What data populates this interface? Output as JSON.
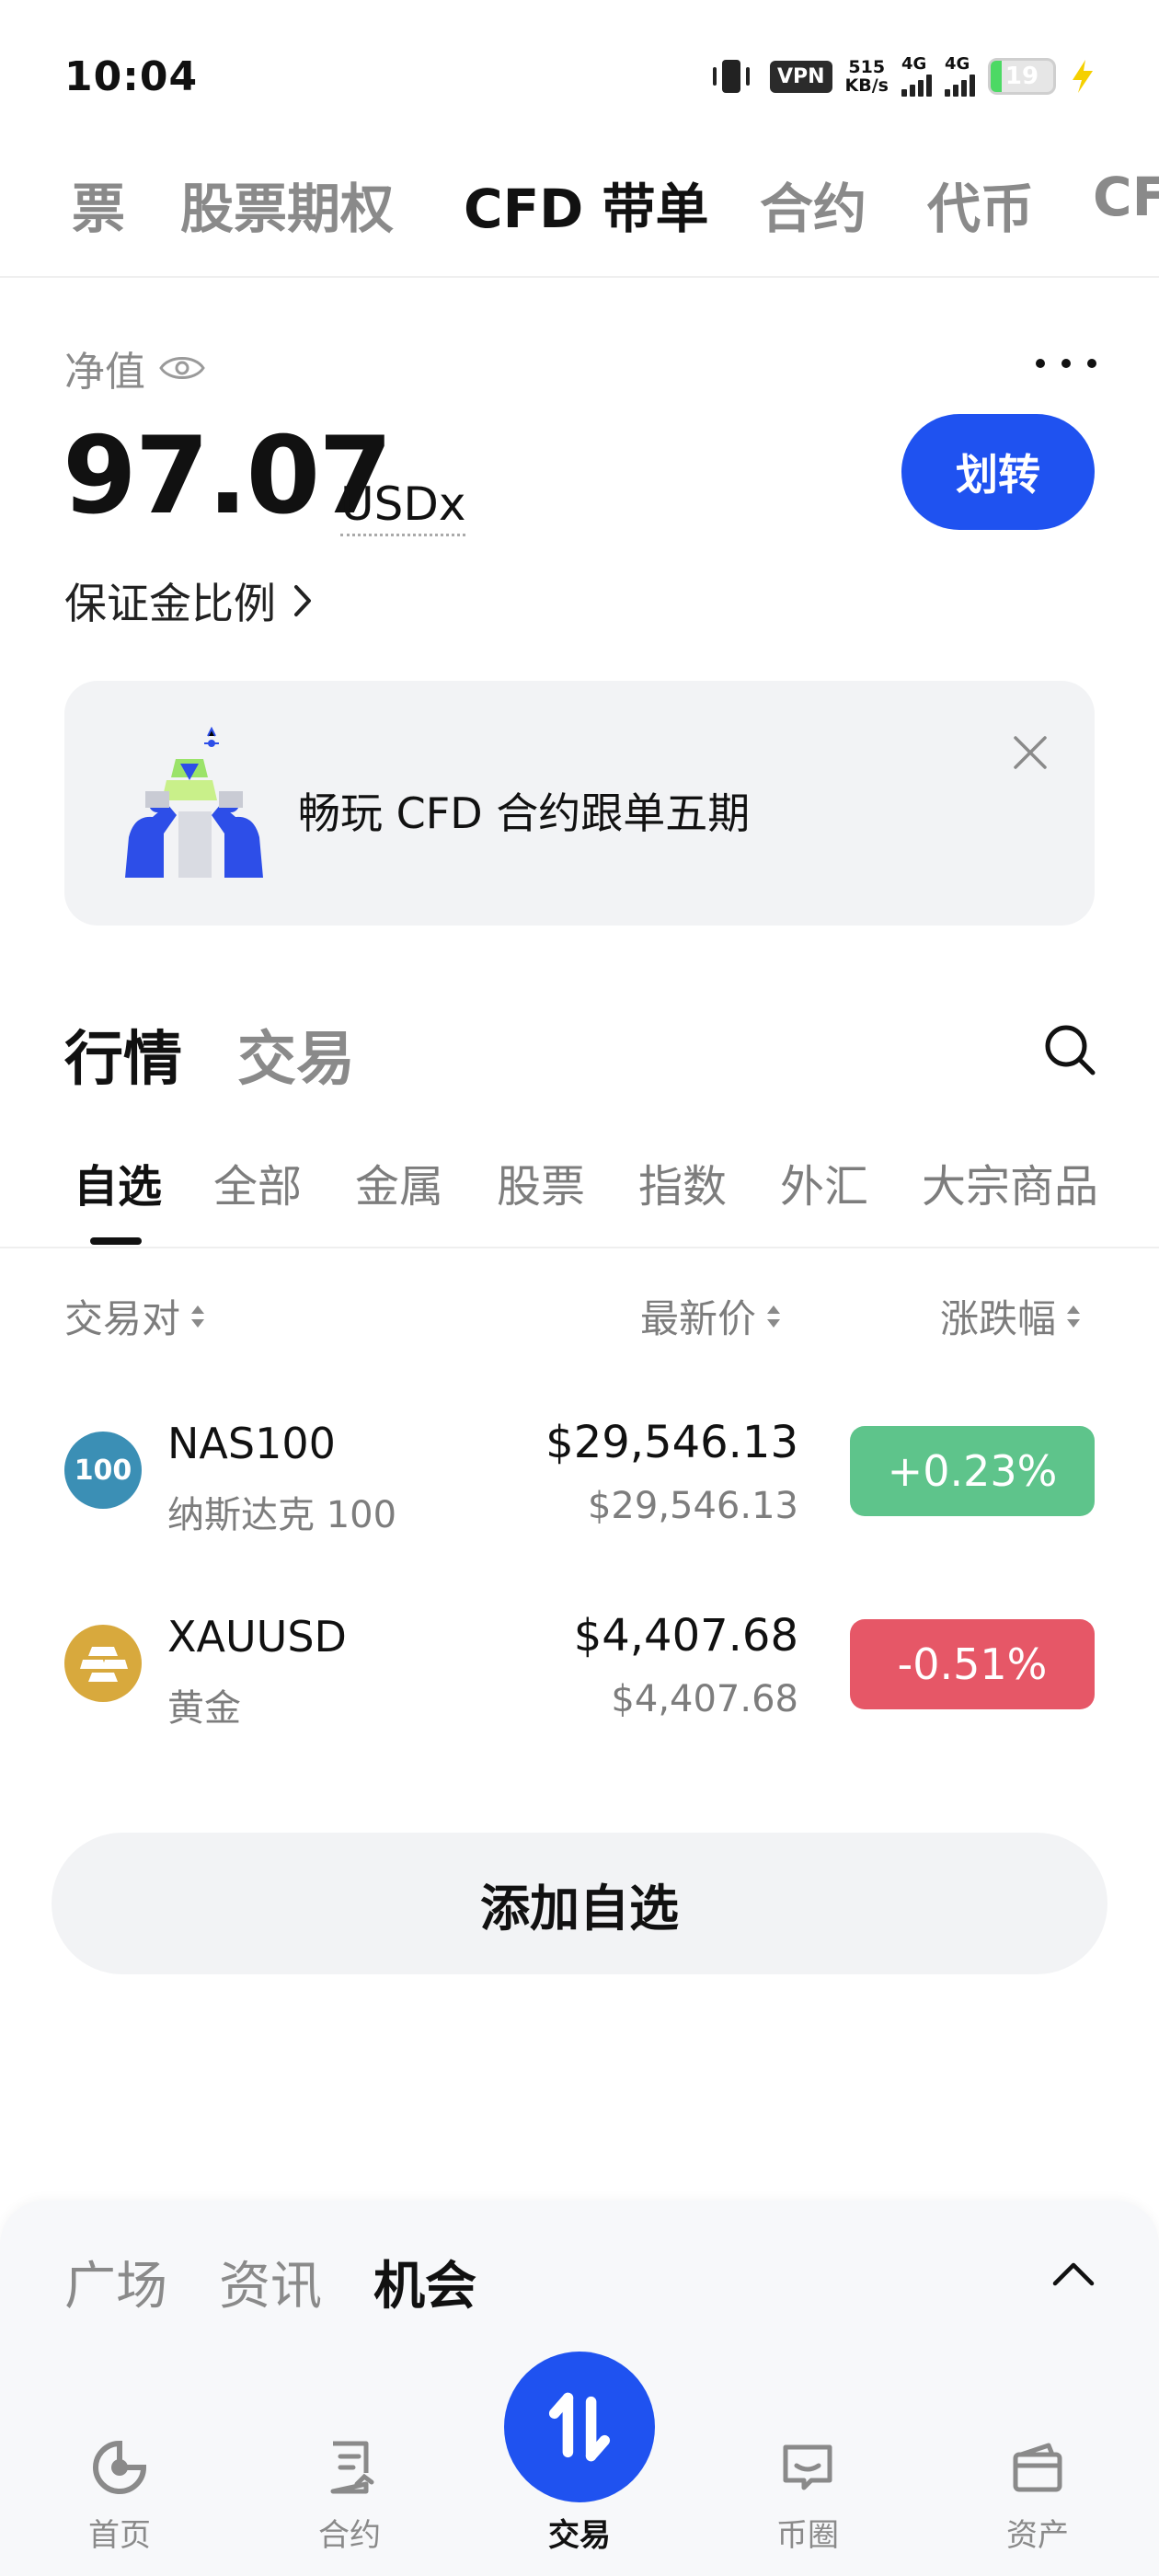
{
  "status_bar": {
    "time": "10:04",
    "vpn": "VPN",
    "speed_value": "515",
    "speed_unit": "KB/s",
    "sig1_label": "4G",
    "sig2_label": "4G",
    "battery": "19"
  },
  "top_tabs": [
    "票",
    "股票期权",
    "CFD 带单",
    "合约",
    "代币",
    "CF"
  ],
  "account": {
    "net_value_label": "净值",
    "net_value": "97.07",
    "unit": "USDx",
    "transfer_label": "划转",
    "margin_ratio_label": "保证金比例"
  },
  "banner": {
    "text": "畅玩 CFD 合约跟单五期"
  },
  "market": {
    "tabs": [
      "行情",
      "交易"
    ],
    "categories": [
      "自选",
      "全部",
      "金属",
      "股票",
      "指数",
      "外汇",
      "大宗商品"
    ],
    "columns": {
      "pair": "交易对",
      "price": "最新价",
      "change": "涨跌幅"
    },
    "rows": [
      {
        "icon_text": "100",
        "symbol": "NAS100",
        "name": "纳斯达克 100",
        "price": "$29,546.13",
        "price_sub": "$29,546.13",
        "change": "+0.23%"
      },
      {
        "icon_text": "",
        "symbol": "XAUUSD",
        "name": "黄金",
        "price": "$4,407.68",
        "price_sub": "$4,407.68",
        "change": "-0.51%"
      }
    ],
    "add_watchlist": "添加自选"
  },
  "feed": {
    "tabs": [
      "广场",
      "资讯",
      "机会"
    ]
  },
  "nav": {
    "items": [
      "首页",
      "合约",
      "交易",
      "币圈",
      "资产"
    ]
  },
  "colors": {
    "accent": "#1f52f0",
    "up": "#5ec48b",
    "down": "#e65767"
  }
}
